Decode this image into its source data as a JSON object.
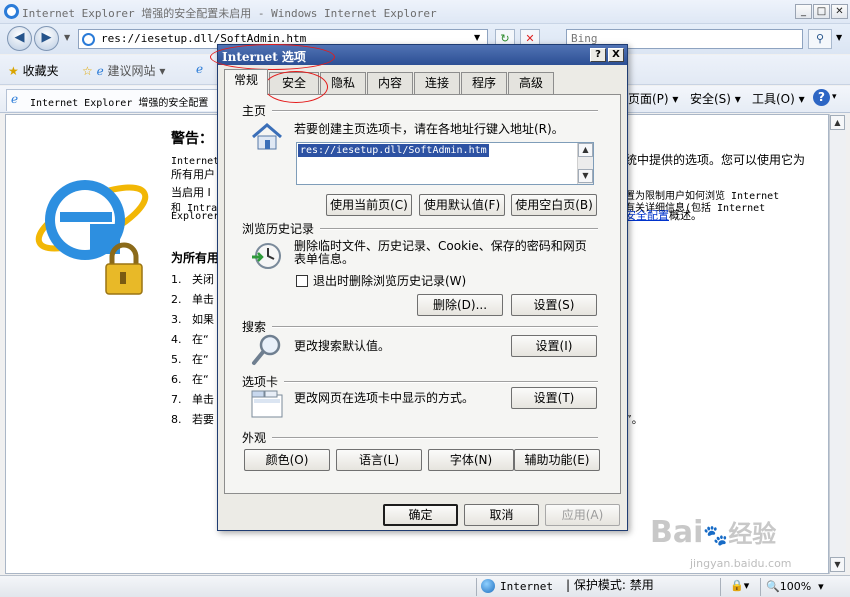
{
  "browser": {
    "window_title": "Internet Explorer 增强的安全配置未启用 - Windows Internet Explorer",
    "address": "res://iesetup.dll/SoftAdmin.htm",
    "search_placeholder": "Bing",
    "favorites_label": "收藏夹",
    "suggested_sites": "建议网站",
    "tab_title": "Internet Explorer 增强的安全配置",
    "menu_page": "页面(P)",
    "menu_safety": "安全(S)",
    "menu_tools": "工具(O)",
    "help_icon": "help-icon"
  },
  "page": {
    "warning_title": "警告：",
    "line1": "Internet",
    "line1_right": "统中提供的选项。您可以使用它为",
    "line2": "所有用户",
    "line3_left": "当启用 I",
    "line3_right": "置为限制用户如何浏览 Internet",
    "line4_left": "和 Intra",
    "line4_right": "有关详细信息(包括 Internet",
    "line5_left": "Explorer",
    "line5_link": "安全配置",
    "line5_after": "概述。",
    "section": "为所有用",
    "steps": [
      {
        "num": "1.",
        "text": "关闭"
      },
      {
        "num": "2.",
        "text": "单击"
      },
      {
        "num": "3.",
        "text": "如果"
      },
      {
        "num": "4.",
        "text": "在“"
      },
      {
        "num": "5.",
        "text": "在“"
      },
      {
        "num": "6.",
        "text": "在“"
      },
      {
        "num": "7.",
        "text": "单击"
      },
      {
        "num": "8.",
        "text": "若要"
      }
    ],
    "step8_tail": "”。"
  },
  "status": {
    "zone": "Internet",
    "protected_mode": "保护模式: 禁用",
    "zoom": "100%"
  },
  "dialog": {
    "title": "Internet 选项",
    "help": "?",
    "close": "X",
    "tabs": [
      "常规",
      "安全",
      "隐私",
      "内容",
      "连接",
      "程序",
      "高级"
    ],
    "homepage": {
      "group": "主页",
      "desc": "若要创建主页选项卡，请在各地址行键入地址(R)。",
      "url": "res://iesetup.dll/SoftAdmin.htm",
      "btn_current": "使用当前页(C)",
      "btn_default": "使用默认值(F)",
      "btn_blank": "使用空白页(B)"
    },
    "history": {
      "group": "浏览历史记录",
      "desc1": "删除临时文件、历史记录、Cookie、保存的密码和网页",
      "desc2": "表单信息。",
      "checkbox": "退出时删除浏览历史记录(W)",
      "btn_delete": "删除(D)...",
      "btn_settings": "设置(S)"
    },
    "search": {
      "group": "搜索",
      "desc": "更改搜索默认值。",
      "btn_settings": "设置(I)"
    },
    "tabs_group": {
      "group": "选项卡",
      "desc": "更改网页在选项卡中显示的方式。",
      "btn_settings": "设置(T)"
    },
    "appearance": {
      "group": "外观",
      "btn_colors": "颜色(O)",
      "btn_languages": "语言(L)",
      "btn_fonts": "字体(N)",
      "btn_accessibility": "辅助功能(E)"
    },
    "btn_ok": "确定",
    "btn_cancel": "取消",
    "btn_apply": "应用(A)"
  },
  "watermark": {
    "brand": "Bai",
    "brand2": "经验",
    "url": "jingyan.baidu.com"
  }
}
